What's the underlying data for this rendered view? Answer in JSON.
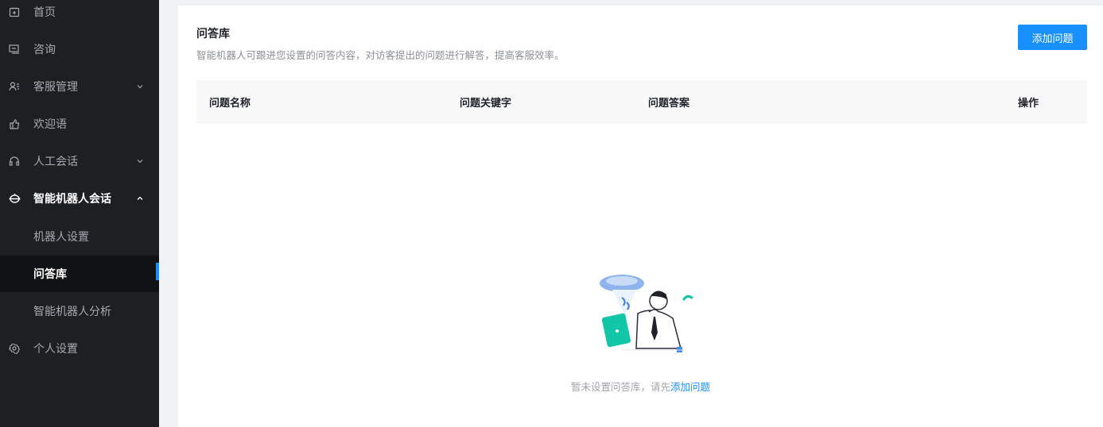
{
  "sidebar": {
    "items": [
      {
        "label": "首页",
        "icon": "home-icon"
      },
      {
        "label": "咨询",
        "icon": "message-icon"
      },
      {
        "label": "客服管理",
        "icon": "user-list-icon"
      },
      {
        "label": "欢迎语",
        "icon": "hand-icon"
      },
      {
        "label": "人工会话",
        "icon": "headset-icon"
      },
      {
        "label": "智能机器人会话",
        "icon": "robot-icon"
      },
      {
        "label": "个人设置",
        "icon": "gear-icon"
      }
    ],
    "submenu": [
      {
        "label": "机器人设置"
      },
      {
        "label": "问答库"
      },
      {
        "label": "智能机器人分析"
      }
    ]
  },
  "main": {
    "title": "问答库",
    "description": "智能机器人可跟进您设置的问答内容，对访客提出的问题进行解答，提高客服效率。",
    "add_button": "添加问题",
    "table": {
      "columns": [
        "问题名称",
        "问题关键字",
        "问题答案",
        "操作"
      ]
    },
    "empty": {
      "text": "暂未设置问答库，请先",
      "link": "添加问题"
    }
  },
  "colors": {
    "accent": "#1890ff",
    "sidebar_bg": "#1d1f23"
  }
}
